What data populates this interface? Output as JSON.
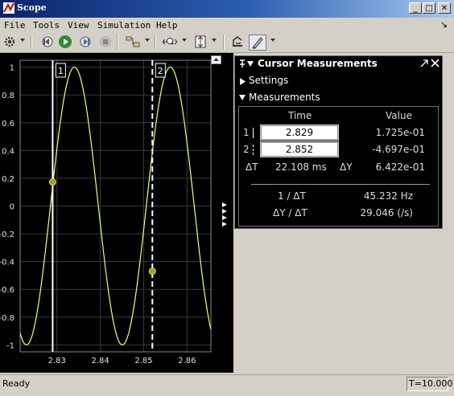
{
  "window": {
    "title": "Scope",
    "buttons": {
      "minimize": "_",
      "maximize": "□",
      "close": "✕"
    }
  },
  "menu": [
    "File",
    "Tools",
    "View",
    "Simulation",
    "Help"
  ],
  "toolbar": {
    "icons": [
      "gear-icon",
      "step-back-icon",
      "run-icon",
      "step-forward-icon",
      "stop-icon",
      "signal-selector-icon",
      "zoom-x-icon",
      "scale-y-icon",
      "dock-style-icon",
      "measurement-cursor-icon"
    ]
  },
  "plot": {
    "y_ticks": [
      "1",
      "0.8",
      "0.6",
      "0.4",
      "0.2",
      "0",
      "-0.2",
      "-0.4",
      "-0.6",
      "-0.8",
      "-1"
    ],
    "x_ticks": [
      "2.83",
      "2.84",
      "2.85",
      "2.86"
    ],
    "cursor1_label": "1",
    "cursor2_label": "2",
    "line_color": "#ffff66",
    "background": "#000000"
  },
  "chart_data": {
    "type": "line",
    "x_range": [
      2.8215,
      2.8655
    ],
    "ylim": [
      -1.05,
      1.05
    ],
    "signal": "sine",
    "period": 0.02211,
    "phase_reference_x": 2.8291,
    "x_ticks": [
      2.83,
      2.84,
      2.85,
      2.86
    ],
    "y_ticks": [
      1,
      0.8,
      0.6,
      0.4,
      0.2,
      0,
      -0.2,
      -0.4,
      -0.6,
      -0.8,
      -1
    ],
    "cursors": [
      {
        "name": "1",
        "x": 2.829,
        "y": 0.1725
      },
      {
        "name": "2",
        "x": 2.852,
        "y": -0.4697
      }
    ]
  },
  "panel": {
    "title": "Cursor Measurements",
    "settings_label": "Settings",
    "measurements_label": "Measurements",
    "col_time": "Time",
    "col_value": "Value",
    "row1_label": "1",
    "row1_time": "2.829",
    "row1_value": "1.725e-01",
    "row2_label": "2",
    "row2_time": "2.852",
    "row2_value": "-4.697e-01",
    "dt_label": "ΔT",
    "dt_value": "22.108 ms",
    "dy_label": "ΔY",
    "dy_value": "6.422e-01",
    "inv_dt_label": "1 / ΔT",
    "inv_dt_value": "45.232 Hz",
    "dydt_label": "ΔY / ΔT",
    "dydt_value": "29.046 (/s)"
  },
  "status": {
    "text": "Ready",
    "time": "T=10.000"
  }
}
